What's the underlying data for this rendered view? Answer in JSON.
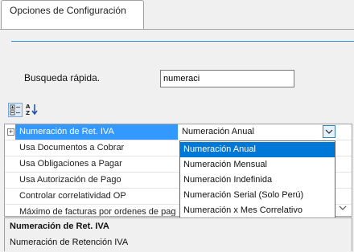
{
  "tab": {
    "label": "Opciones de Configuración"
  },
  "search": {
    "label": "Busqueda rápida.",
    "value": "numeraci"
  },
  "toolbar": {
    "categorized_icon": "categorized-icon",
    "alphabetical_icon": "sort-alphabetical-icon"
  },
  "grid": {
    "rows": [
      {
        "name": "Numeración de Ret. IVA",
        "selected": true
      },
      {
        "name": "Usa Documentos a Cobrar"
      },
      {
        "name": "Usa Obligaciones a Pagar"
      },
      {
        "name": "Usa Autorización de Pago"
      },
      {
        "name": "Controlar correlatividad OP"
      },
      {
        "name": "Máximo de facturas por ordenes de pag"
      }
    ],
    "selected_value": "Numeración Anual"
  },
  "dropdown": {
    "options": [
      "Numeración Anual",
      "Numeración Mensual",
      "Numeración Indefinida",
      "Numeración Serial (Solo Perú)",
      "Numeración x Mes Correlativo"
    ],
    "selected_index": 0
  },
  "description": {
    "title": "Numeración de Ret. IVA",
    "text": "Numeración de Retención IVA"
  },
  "colors": {
    "selection": "#3399ff",
    "dropdown_selection": "#0078d7",
    "rule": "#3a8fd6"
  }
}
